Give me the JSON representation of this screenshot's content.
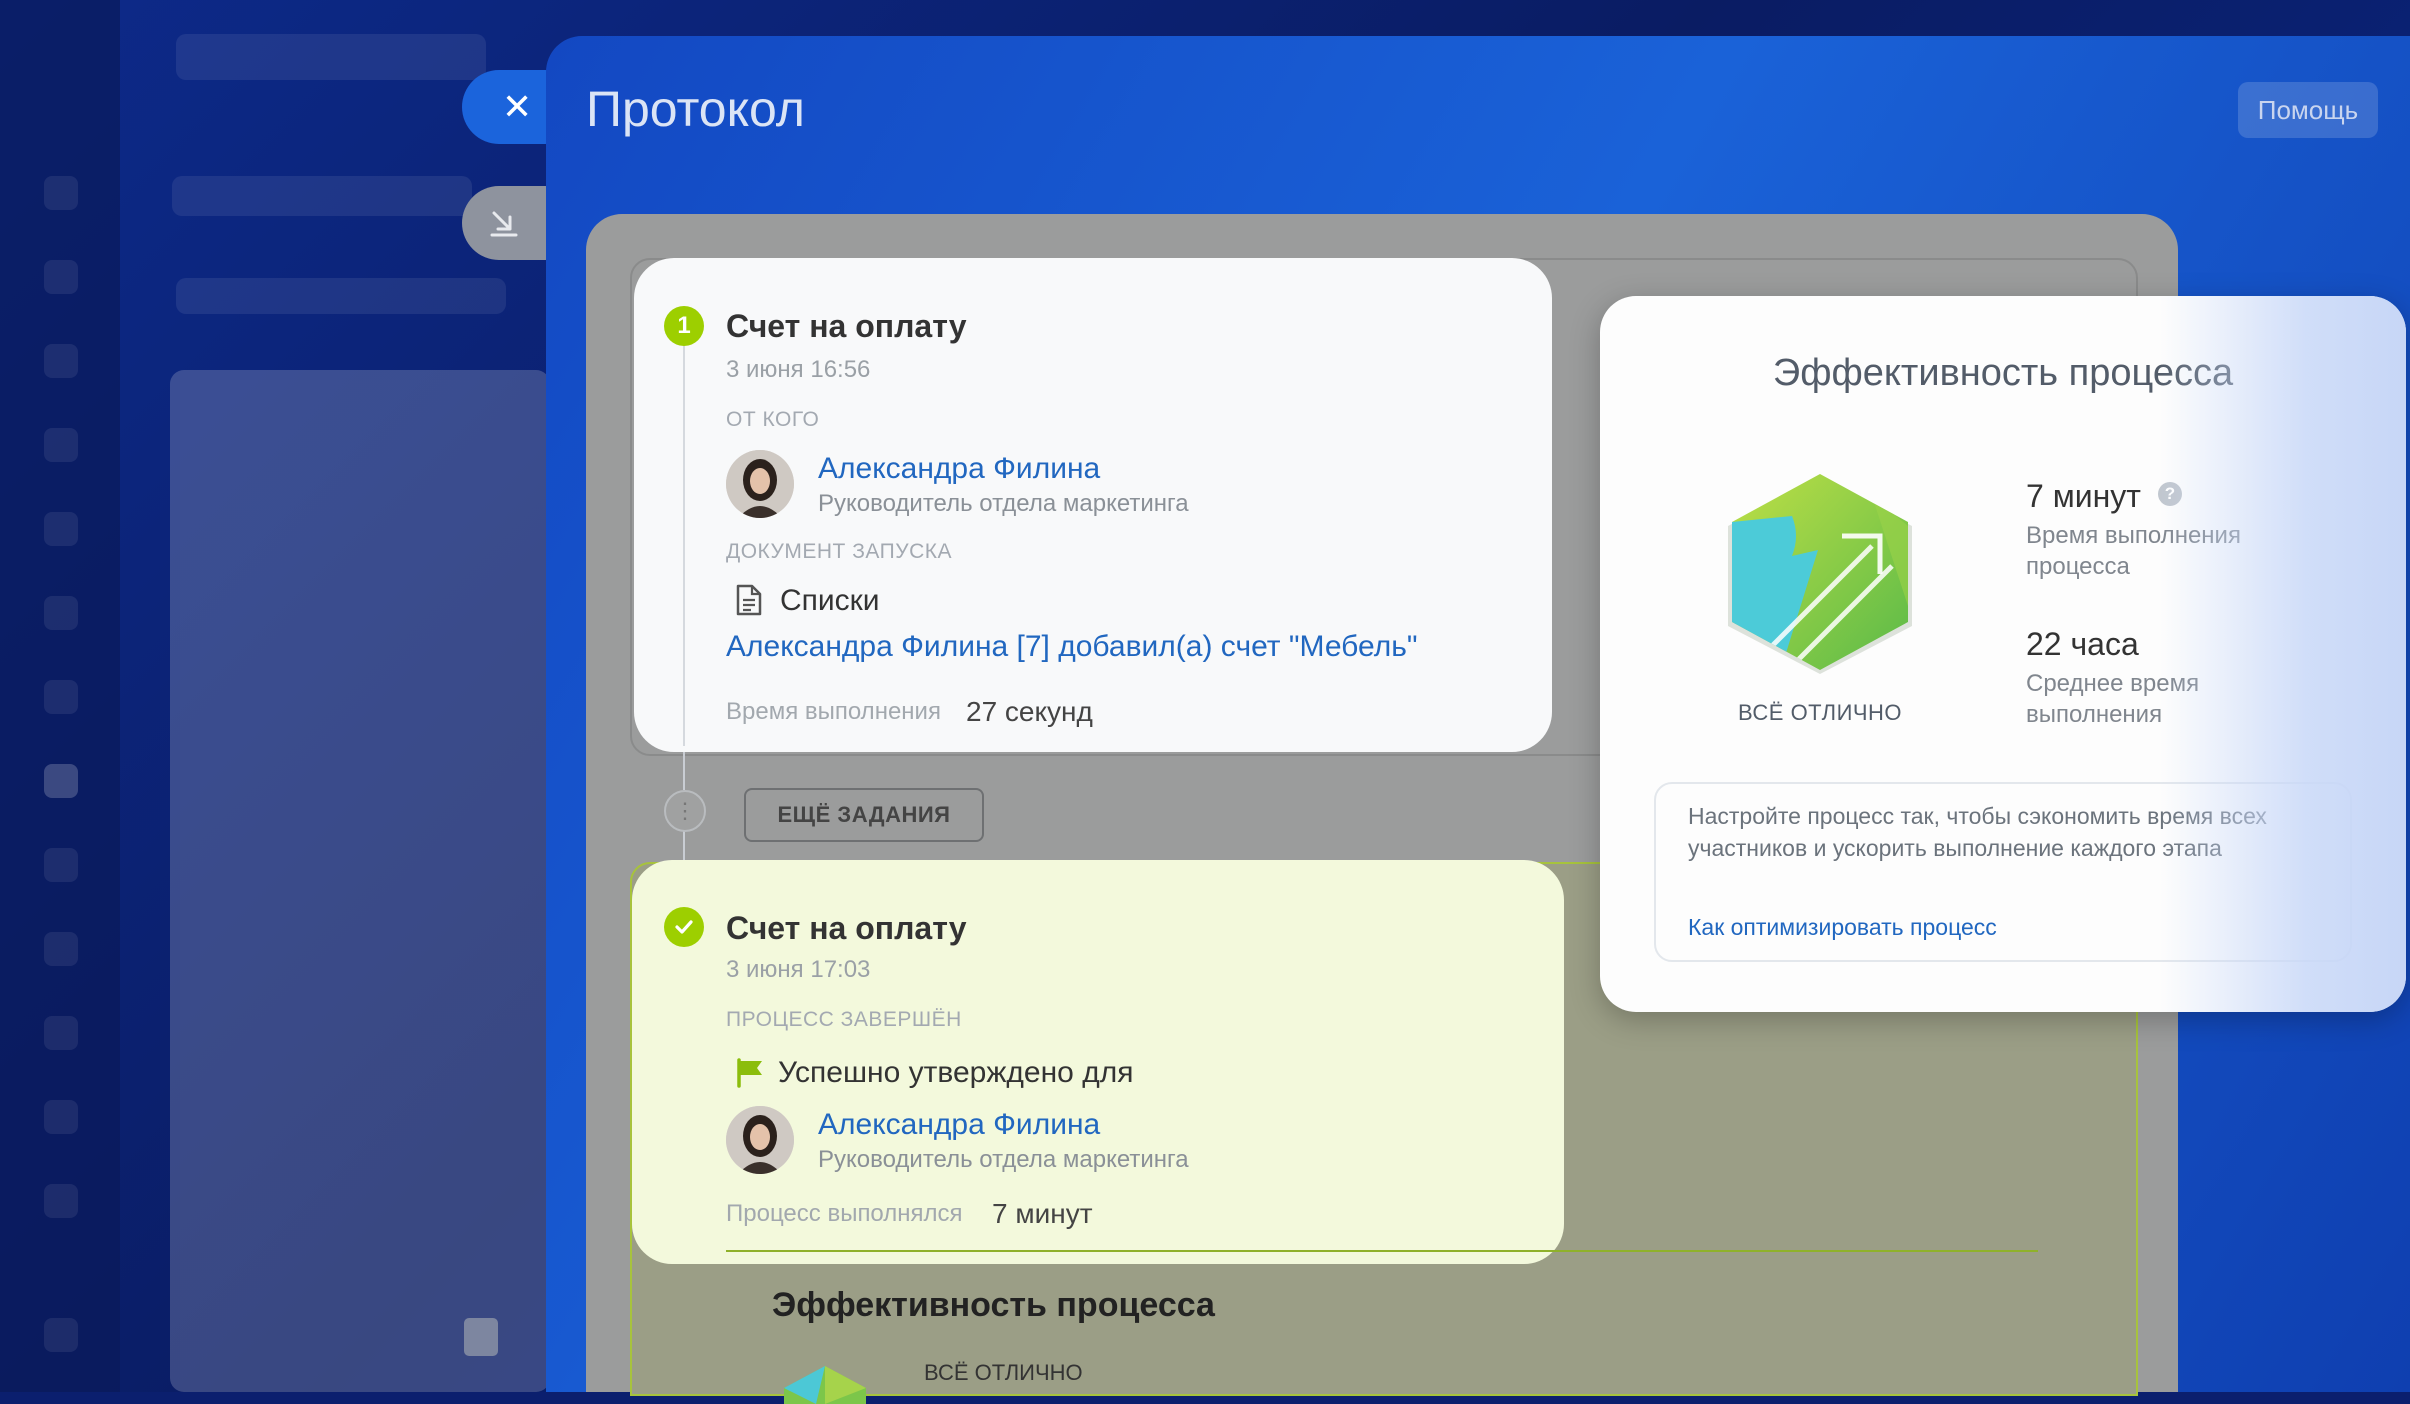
{
  "header": {
    "title": "Протокол",
    "help_label": "Помощь"
  },
  "task1": {
    "step_number": "1",
    "title": "Счет на оплату",
    "date": "3 июня 16:56",
    "from_label": "ОТ КОГО",
    "person_name": "Александра Филина",
    "person_position": "Руководитель отдела маркетинга",
    "document_label": "ДОКУМЕНТ ЗАПУСКА",
    "document_name": "Списки",
    "document_link": "Александра Филина [7] добавил(а) счет \"Мебель\"",
    "time_label": "Время выполнения",
    "time_value": "27 секунд"
  },
  "more_tasks_label": "ЕЩЁ ЗАДАНИЯ",
  "task2": {
    "title": "Счет на оплату",
    "date": "3 июня 17:03",
    "status_label": "ПРОЦЕСС ЗАВЕРШЁН",
    "result_text": "Успешно утверждено для",
    "person_name": "Александра Филина",
    "person_position": "Руководитель отдела маркетинга",
    "duration_label": "Процесс выполнялся",
    "duration_value": "7 минут"
  },
  "background_section": {
    "title": "Эффективность процесса",
    "rating": "ВСЁ ОТЛИЧНО"
  },
  "efficiency_popup": {
    "title": "Эффективность процесса",
    "rating": "ВСЁ ОТЛИЧНО",
    "stat1_value": "7 минут",
    "stat1_label": "Время выполнения процесса",
    "stat2_value": "22 часа",
    "stat2_label": "Среднее время выполнения",
    "tip_text": "Настройте процесс так, чтобы сэкономить время всех участников и ускорить выполнение каждого этапа",
    "tip_link": "Как оптимизировать процесс"
  },
  "colors": {
    "accent_green": "#9dcf00",
    "link_blue": "#2167c0",
    "slider_blue": "#1a62d8"
  }
}
